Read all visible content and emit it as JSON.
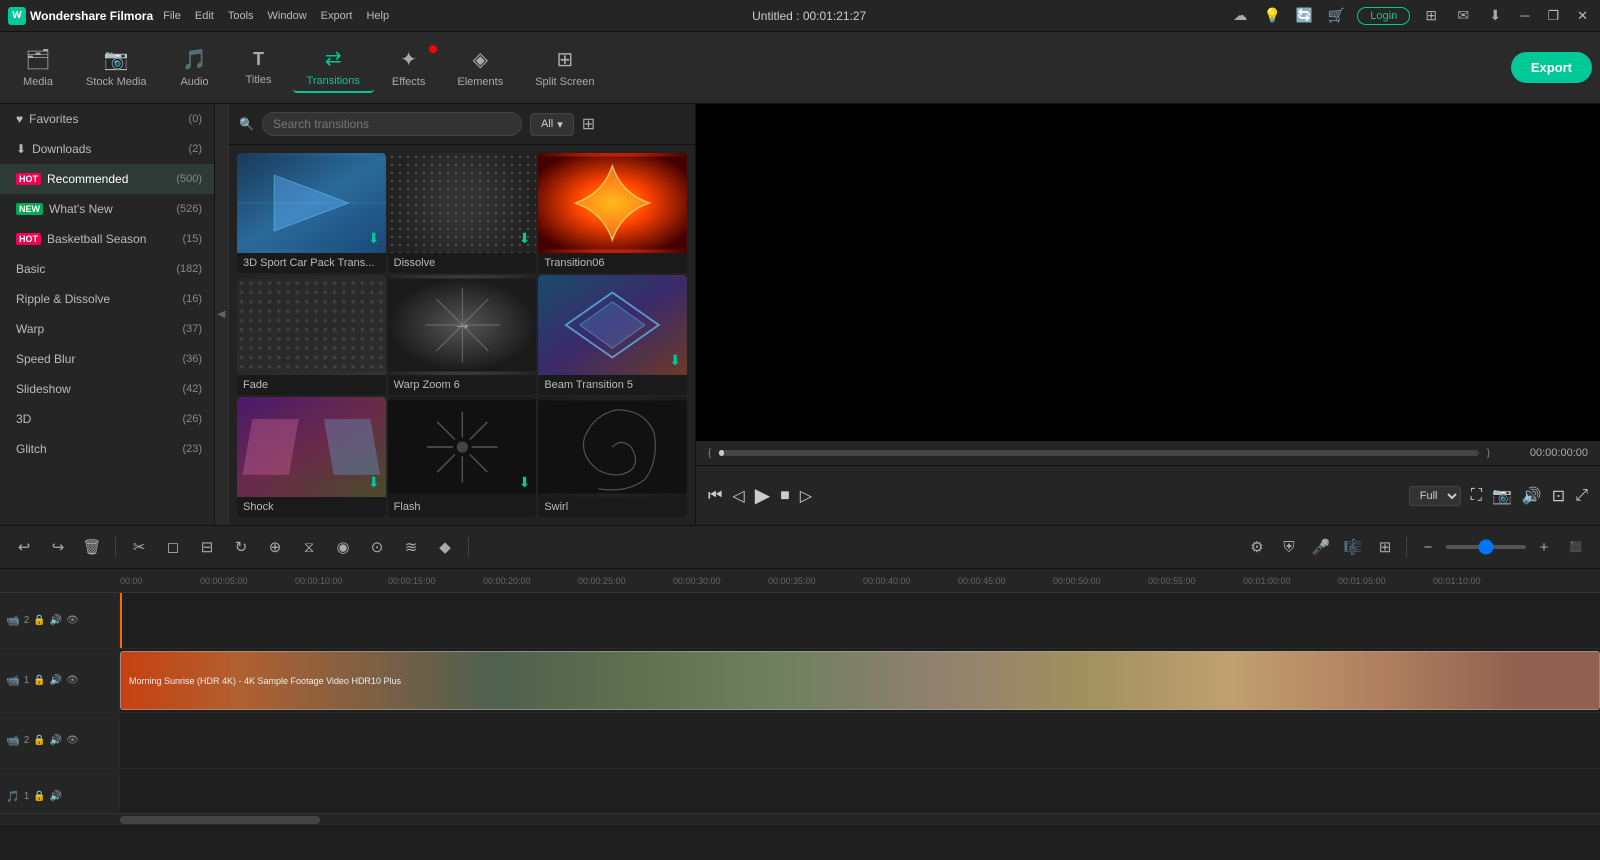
{
  "app": {
    "name": "Wondershare Filmora",
    "title": "Untitled : 00:01:21:27"
  },
  "menu": {
    "items": [
      "File",
      "Edit",
      "Tools",
      "Window",
      "Export",
      "Help"
    ]
  },
  "titlebar": {
    "login_label": "Login",
    "window_controls": [
      "─",
      "❐",
      "✕"
    ]
  },
  "toolbar": {
    "items": [
      {
        "id": "media",
        "label": "Media",
        "icon": "🗂"
      },
      {
        "id": "stock-media",
        "label": "Stock Media",
        "icon": "🎬"
      },
      {
        "id": "audio",
        "label": "Audio",
        "icon": "🎵"
      },
      {
        "id": "titles",
        "label": "Titles",
        "icon": "T"
      },
      {
        "id": "transitions",
        "label": "Transitions",
        "icon": "⇄",
        "active": true
      },
      {
        "id": "effects",
        "label": "Effects",
        "icon": "✦",
        "badge": true
      },
      {
        "id": "elements",
        "label": "Elements",
        "icon": "◈"
      },
      {
        "id": "split-screen",
        "label": "Split Screen",
        "icon": "⊞"
      }
    ],
    "export_label": "Export"
  },
  "left_panel": {
    "items": [
      {
        "id": "favorites",
        "label": "Favorites",
        "count": "(0)",
        "icon": "♥",
        "badge": null
      },
      {
        "id": "downloads",
        "label": "Downloads",
        "count": "(2)",
        "icon": "⬇",
        "badge": null
      },
      {
        "id": "recommended",
        "label": "Recommended",
        "count": "(500)",
        "badge": "HOT",
        "active": true
      },
      {
        "id": "whats-new",
        "label": "What's New",
        "count": "(526)",
        "badge": "NEW"
      },
      {
        "id": "basketball",
        "label": "Basketball Season",
        "count": "(15)",
        "badge": "HOT"
      },
      {
        "id": "basic",
        "label": "Basic",
        "count": "(182)"
      },
      {
        "id": "ripple",
        "label": "Ripple & Dissolve",
        "count": "(16)"
      },
      {
        "id": "warp",
        "label": "Warp",
        "count": "(37)"
      },
      {
        "id": "speed-blur",
        "label": "Speed Blur",
        "count": "(36)"
      },
      {
        "id": "slideshow",
        "label": "Slideshow",
        "count": "(42)"
      },
      {
        "id": "3d",
        "label": "3D",
        "count": "(26)"
      },
      {
        "id": "glitch",
        "label": "Glitch",
        "count": "(23)"
      }
    ]
  },
  "search": {
    "placeholder": "Search transitions",
    "filter_label": "All"
  },
  "transitions": {
    "items": [
      {
        "id": "3d-sport",
        "label": "3D Sport Car Pack Trans...",
        "thumb_class": "thumb-3d-sport",
        "has_dl": true
      },
      {
        "id": "dissolve",
        "label": "Dissolve",
        "thumb_class": "thumb-dissolve",
        "has_dl": true
      },
      {
        "id": "transition06",
        "label": "Transition06",
        "thumb_class": "thumb-transition06",
        "has_dl": false
      },
      {
        "id": "fade",
        "label": "Fade",
        "thumb_class": "thumb-fade",
        "has_dl": false
      },
      {
        "id": "warp-zoom",
        "label": "Warp Zoom 6",
        "thumb_class": "thumb-warp-zoom",
        "has_dl": false
      },
      {
        "id": "beam",
        "label": "Beam Transition 5",
        "thumb_class": "thumb-beam",
        "has_dl": true
      },
      {
        "id": "shock",
        "label": "Shock",
        "thumb_class": "thumb-shock",
        "has_dl": true
      },
      {
        "id": "flash",
        "label": "Flash",
        "thumb_class": "thumb-flash",
        "has_dl": true
      },
      {
        "id": "swirl",
        "label": "Swirl",
        "thumb_class": "thumb-swirl",
        "has_dl": false
      }
    ]
  },
  "preview": {
    "time_current": "00:00:00:00",
    "time_start": "{",
    "time_end": "}",
    "quality": "Full",
    "controls": {
      "rewind": "⏮",
      "frame_back": "◁",
      "play": "▶",
      "stop": "■",
      "frame_fwd": "▷"
    }
  },
  "timeline_toolbar": {
    "undo": "↩",
    "redo": "↪",
    "delete": "🗑",
    "cut": "✂",
    "buttons": [
      "↩",
      "↪",
      "🗑",
      "✂",
      "◻",
      "⟳",
      "⊟",
      "⊞",
      "⧖",
      "⊕",
      "≡",
      "⊕"
    ]
  },
  "timeline": {
    "current_time": "00:00",
    "ticks": [
      "00:00",
      "00:00:05:00",
      "00:00:10:00",
      "00:00:15:00",
      "00:00:20:00",
      "00:00:25:00",
      "00:00:30:00",
      "00:00:35:00",
      "00:00:40:00",
      "00:00:45:00",
      "00:00:50:00",
      "00:00:55:00",
      "00:01:00:00",
      "00:01:05:00",
      "00:01:10:00"
    ],
    "tracks": [
      {
        "id": "track1",
        "type": "video",
        "label": "V2",
        "icons": [
          "📹",
          "🔒",
          "🔊",
          "👁"
        ],
        "has_clip": false
      },
      {
        "id": "track2",
        "type": "video",
        "label": "V1",
        "icons": [
          "📹",
          "🔒",
          "🔊",
          "👁"
        ],
        "has_clip": true,
        "clip_text": "Morning Sunrise (HDR 4K) - 4K Sample Footage Video HDR10 Plus"
      },
      {
        "id": "track3",
        "type": "video2",
        "label": "V2",
        "icons": [
          "📹",
          "🔒",
          "🔊",
          "👁"
        ],
        "has_clip": false
      },
      {
        "id": "track4",
        "type": "audio",
        "label": "A1",
        "icons": [
          "🎵",
          "🔒",
          "🔊"
        ],
        "has_clip": false
      }
    ]
  }
}
